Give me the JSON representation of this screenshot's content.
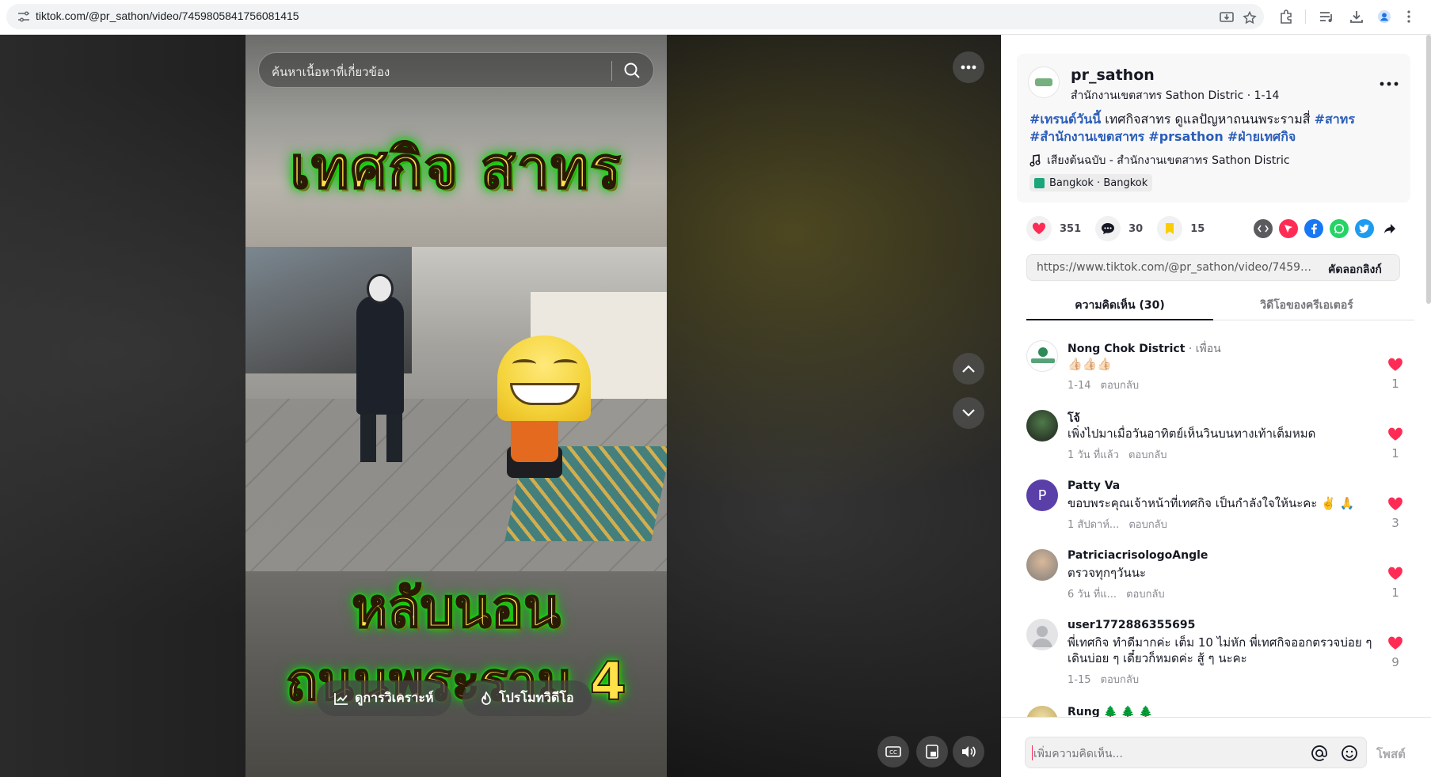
{
  "browser": {
    "url": "tiktok.com/@pr_sathon/video/7459805841756081415",
    "icons": [
      "site-settings-icon",
      "install-app-icon",
      "bookmark-star-icon",
      "extensions-icon",
      "media-control-icon",
      "download-icon",
      "profile-icon"
    ]
  },
  "player": {
    "search_placeholder": "ค้นหาเนื้อหาที่เกี่ยวข้อง",
    "overlay_title_top": "เทศกิจ สาทร",
    "overlay_title_bottom_1": "หลับนอน",
    "overlay_title_bottom_2": "ถนนพระราม 4",
    "analytics_button": "ดูการวิเคราะห์",
    "promote_button": "โปรโมทวิดีโอ"
  },
  "author": {
    "username": "pr_sathon",
    "subtitle": "สำนักงานเขตสาทร Sathon Distric · 1-14",
    "caption_parts": [
      {
        "text": "#เทรนด์วันนี้",
        "tag": true
      },
      {
        "text": " เทศกิจสาทร ดูแลปัญหาถนนพระรามสี่ ",
        "tag": false
      },
      {
        "text": "#สาทร",
        "tag": true
      },
      {
        "text": " ",
        "tag": false
      },
      {
        "text": "#สำนักงานเขตสาทร",
        "tag": true
      },
      {
        "text": " ",
        "tag": false
      },
      {
        "text": "#prsathon",
        "tag": true
      },
      {
        "text": " ",
        "tag": false
      },
      {
        "text": "#ฝ่ายเทศกิจ",
        "tag": true
      }
    ],
    "music": "เสียงต้นฉบับ - สำนักงานเขตสาทร Sathon Distric",
    "location": "Bangkok · Bangkok"
  },
  "stats": {
    "likes": "351",
    "comments": "30",
    "saves": "15"
  },
  "share": {
    "link": "https://www.tiktok.com/@pr_sathon/video/7459805...",
    "copy_label": "คัดลอกลิงก์",
    "icons": [
      "embed-icon",
      "send-to-friends-icon",
      "facebook-icon",
      "whatsapp-icon",
      "twitter-icon",
      "share-arrow-icon"
    ]
  },
  "tabs": {
    "comments": "ความคิดเห็น (30)",
    "creator_videos": "วิดีโอของครีเอเตอร์"
  },
  "comments": [
    {
      "name": "Nong Chok District",
      "friend": " · เพื่อน",
      "text": "👍🏻👍🏻👍🏻",
      "time": "1-14",
      "reply": "ตอบกลับ",
      "likes": "1"
    },
    {
      "name": "โจ้",
      "friend": "",
      "text": "เพิ่งไปมาเมื่อวันอาทิตย์เห็นวินบนทางเท้าเต็มหมด",
      "time": "1 วัน ที่แล้ว",
      "reply": "ตอบกลับ",
      "likes": "1"
    },
    {
      "name": "Patty Va",
      "friend": "",
      "text": "ขอบพระคุณเจ้าหน้าที่เทศกิจ เป็นกำลังใจให้นะคะ ✌️ 🙏",
      "time": "1 สัปดาห์...",
      "reply": "ตอบกลับ",
      "likes": "3"
    },
    {
      "name": "PatriciacrisologoAngle",
      "friend": "",
      "text": "ตรวจทุกๆวันนะ",
      "time": "6 วัน ที่แ...",
      "reply": "ตอบกลับ",
      "likes": "1"
    },
    {
      "name": "user1772886355695",
      "friend": "",
      "text": "พี่เทศกิจ ทำดีมากค่ะ เต็ม 10 ไม่หัก พี่เทศกิจออกตรวจบ่อย ๆ เดินบ่อย ๆ เดี๋ยวก็หมดค่ะ สู้ ๆ นะคะ",
      "time": "1-15",
      "reply": "ตอบกลับ",
      "likes": "9"
    },
    {
      "name": "Rung 🌲 🌲 🌲",
      "friend": "",
      "text": "",
      "time": "",
      "reply": "",
      "likes": ""
    }
  ],
  "comment_input": {
    "placeholder": "เพิ่มความคิดเห็น...",
    "post_label": "โพสต์"
  },
  "colors": {
    "like_red": "#fe2c55",
    "save_yellow": "#facd00",
    "hashtag_blue": "#2b5db9"
  }
}
